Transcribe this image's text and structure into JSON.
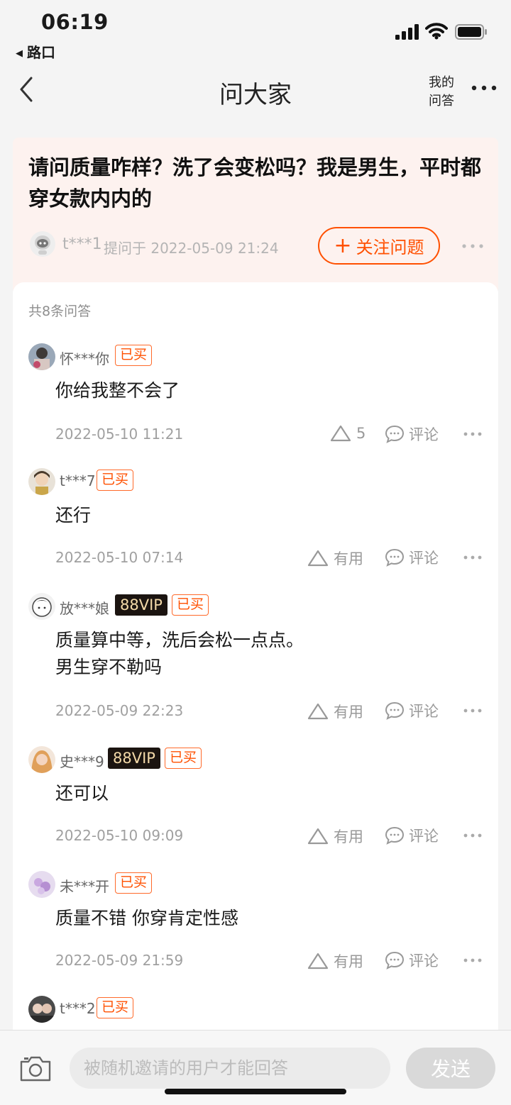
{
  "status": {
    "time": "06:19",
    "back_app": "路口"
  },
  "nav": {
    "title": "问大家",
    "my_qa_line1": "我的",
    "my_qa_line2": "问答"
  },
  "question": {
    "text": "请问质量咋样？洗了会变松吗？我是男生，平时都穿女款内内的",
    "user": "t***1",
    "asked": "提问于 2022-05-09 21:24",
    "follow_label": "关注问题"
  },
  "answers_count": "共8条问答",
  "answers": [
    {
      "user": "怀***你",
      "vip": "",
      "bought": "已买",
      "content": "你给我整不会了",
      "time": "2022-05-10 11:21",
      "like": "5",
      "comment": "评论"
    },
    {
      "user": "t***7",
      "vip": "",
      "bought": "已买",
      "content": "还行",
      "time": "2022-05-10 07:14",
      "like": "有用",
      "comment": "评论"
    },
    {
      "user": "放***娘",
      "vip": "88VIP",
      "bought": "已买",
      "content": "质量算中等，洗后会松一点点。\n男生穿不勒吗",
      "time": "2022-05-09 22:23",
      "like": "有用",
      "comment": "评论"
    },
    {
      "user": "史***9",
      "vip": "88VIP",
      "bought": "已买",
      "content": "还可以",
      "time": "2022-05-10 09:09",
      "like": "有用",
      "comment": "评论"
    },
    {
      "user": "未***开",
      "vip": "",
      "bought": "已买",
      "content": "质量不错 你穿肯定性感",
      "time": "2022-05-09 21:59",
      "like": "有用",
      "comment": "评论"
    },
    {
      "user": "t***2",
      "vip": "",
      "bought": "已买",
      "content": "",
      "time": "",
      "like": "",
      "comment": ""
    }
  ],
  "bottom": {
    "placeholder": "被随机邀请的用户才能回答",
    "send": "发送"
  },
  "colors": {
    "accent": "#ff5000",
    "header_bg": "#fdf2ef",
    "vip_bg": "#1b1410",
    "vip_text": "#f3d9a8"
  }
}
